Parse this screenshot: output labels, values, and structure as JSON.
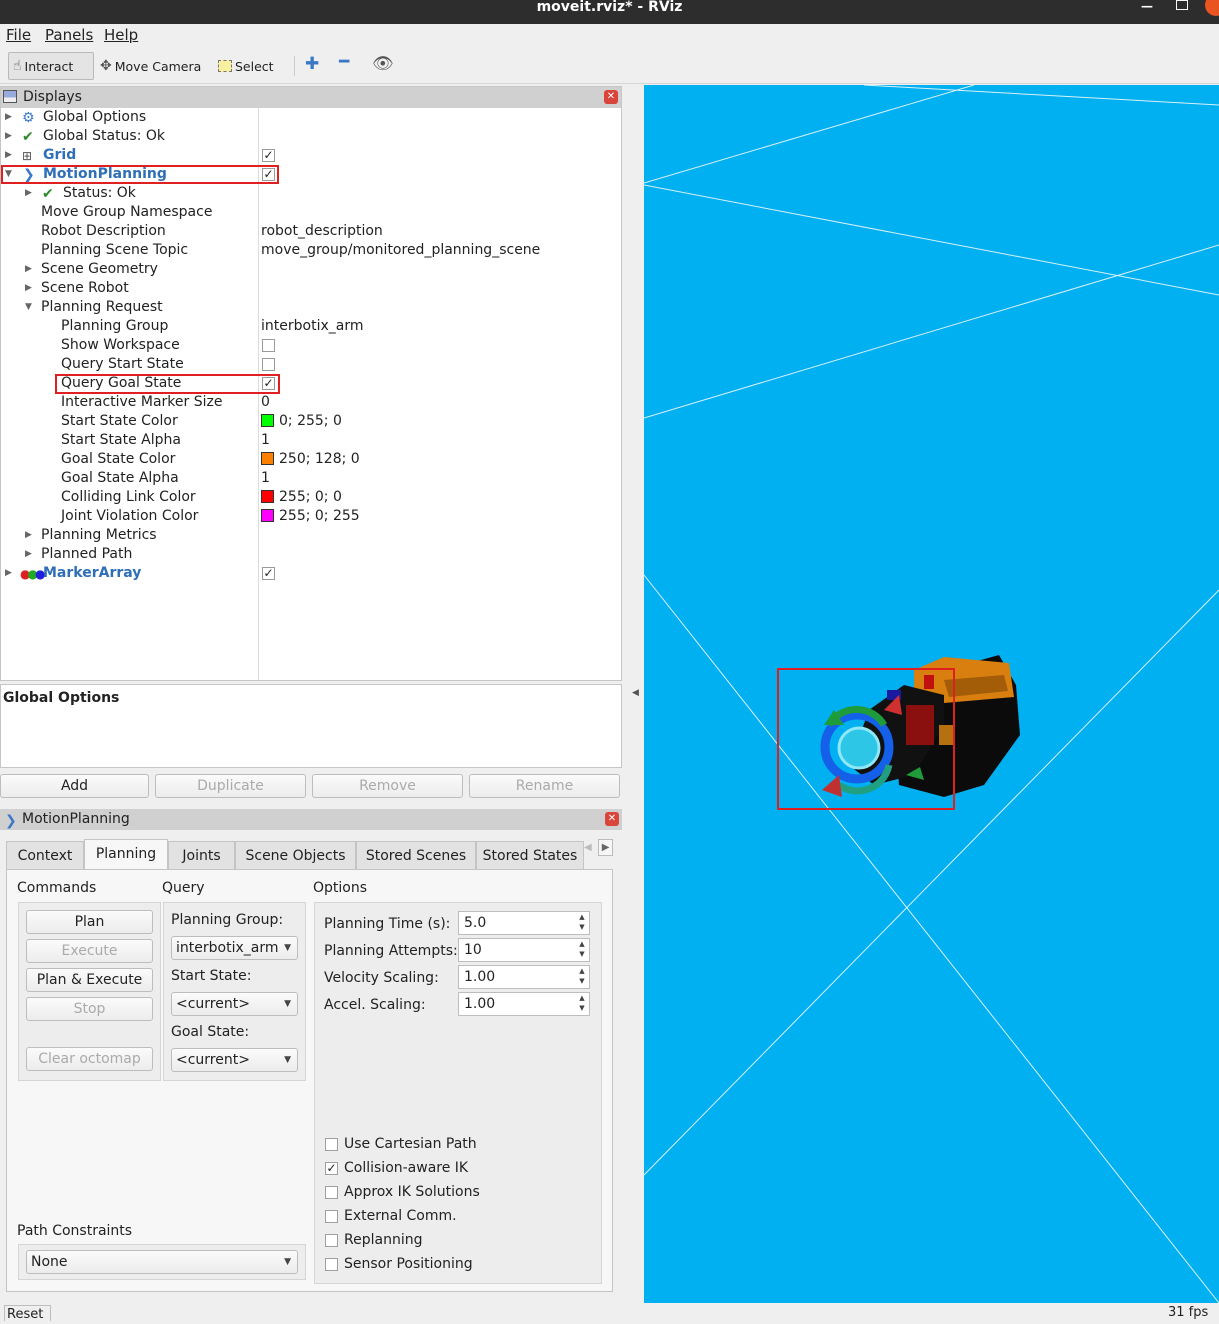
{
  "window": {
    "title": "moveit.rviz* - RViz"
  },
  "menu": {
    "file": "File",
    "panels": "Panels",
    "help": "Help"
  },
  "toolbar": {
    "interact": "Interact",
    "move_camera": "Move Camera",
    "select": "Select"
  },
  "displays": {
    "title": "Displays",
    "rows": [
      {
        "label": "Global Options"
      },
      {
        "label": "Global Status: Ok"
      },
      {
        "label": "Grid",
        "checked": true
      },
      {
        "label": "MotionPlanning",
        "checked": true
      },
      {
        "label": "Status: Ok"
      },
      {
        "label": "Move Group Namespace",
        "value": ""
      },
      {
        "label": "Robot Description",
        "value": "robot_description"
      },
      {
        "label": "Planning Scene Topic",
        "value": "move_group/monitored_planning_scene"
      },
      {
        "label": "Scene Geometry"
      },
      {
        "label": "Scene Robot"
      },
      {
        "label": "Planning Request"
      },
      {
        "label": "Planning Group",
        "value": "interbotix_arm"
      },
      {
        "label": "Show Workspace",
        "checked": false
      },
      {
        "label": "Query Start State",
        "checked": false
      },
      {
        "label": "Query Goal State",
        "checked": true
      },
      {
        "label": "Interactive Marker Size",
        "value": "0"
      },
      {
        "label": "Start State Color",
        "value": "0; 255; 0",
        "color": "#00ff00"
      },
      {
        "label": "Start State Alpha",
        "value": "1"
      },
      {
        "label": "Goal State Color",
        "value": "250; 128; 0",
        "color": "#fa8000"
      },
      {
        "label": "Goal State Alpha",
        "value": "1"
      },
      {
        "label": "Colliding Link Color",
        "value": "255; 0; 0",
        "color": "#ff0000"
      },
      {
        "label": "Joint Violation Color",
        "value": "255; 0; 255",
        "color": "#ff00ff"
      },
      {
        "label": "Planning Metrics"
      },
      {
        "label": "Planned Path"
      },
      {
        "label": "MarkerArray",
        "checked": true
      }
    ]
  },
  "description": {
    "title": "Global Options"
  },
  "display_buttons": {
    "add": "Add",
    "duplicate": "Duplicate",
    "remove": "Remove",
    "rename": "Rename"
  },
  "motion_planning": {
    "title": "MotionPlanning",
    "tabs": [
      "Context",
      "Planning",
      "Joints",
      "Scene Objects",
      "Stored Scenes",
      "Stored States"
    ],
    "active_tab": "Planning",
    "commands": {
      "title": "Commands",
      "plan": "Plan",
      "execute": "Execute",
      "plan_execute": "Plan & Execute",
      "stop": "Stop",
      "clear_octomap": "Clear octomap"
    },
    "query": {
      "title": "Query",
      "planning_group_label": "Planning Group:",
      "planning_group": "interbotix_arm",
      "start_state_label": "Start State:",
      "start_state": "<current>",
      "goal_state_label": "Goal State:",
      "goal_state": "<current>"
    },
    "options": {
      "title": "Options",
      "planning_time_label": "Planning Time (s):",
      "planning_time": "5.0",
      "planning_attempts_label": "Planning Attempts:",
      "planning_attempts": "10",
      "velocity_scaling_label": "Velocity Scaling:",
      "velocity_scaling": "1.00",
      "accel_scaling_label": "Accel. Scaling:",
      "accel_scaling": "1.00",
      "checkboxes": [
        {
          "label": "Use Cartesian Path",
          "checked": false
        },
        {
          "label": "Collision-aware IK",
          "checked": true
        },
        {
          "label": "Approx IK Solutions",
          "checked": false
        },
        {
          "label": "External Comm.",
          "checked": false
        },
        {
          "label": "Replanning",
          "checked": false
        },
        {
          "label": "Sensor Positioning",
          "checked": false
        }
      ]
    },
    "path_constraints": {
      "title": "Path Constraints",
      "value": "None"
    }
  },
  "status": {
    "reset": "Reset",
    "fps": "31 fps"
  },
  "colors": {
    "viewport_bg": "#00b0f0",
    "highlight": "#e02020",
    "link_blue": "#2e6fb7"
  }
}
